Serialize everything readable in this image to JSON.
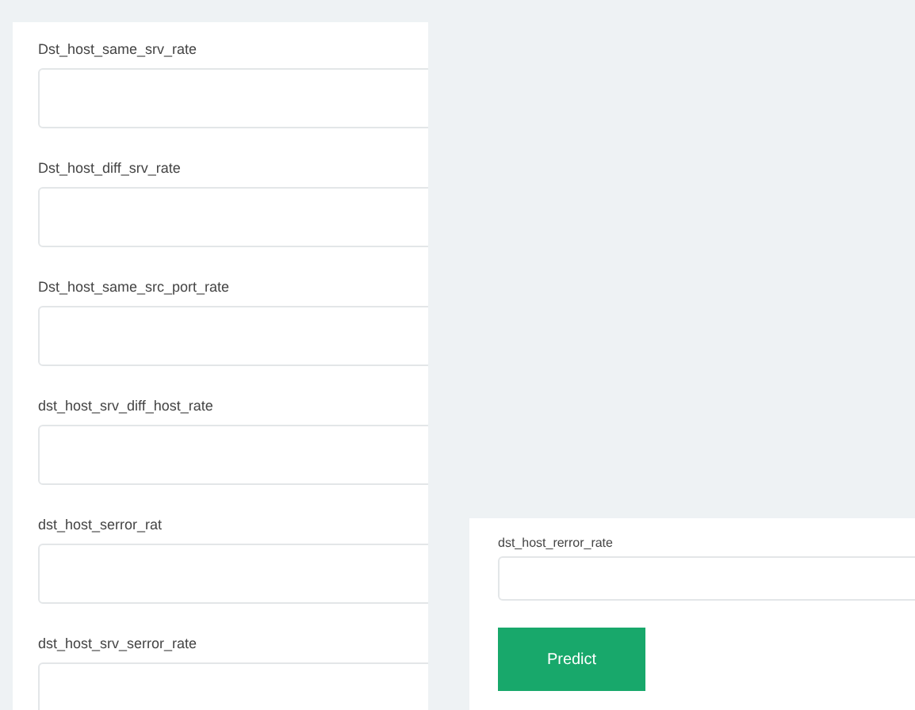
{
  "left_form": {
    "fields": [
      {
        "label": "Dst_host_same_srv_rate"
      },
      {
        "label": "Dst_host_diff_srv_rate"
      },
      {
        "label": "Dst_host_same_src_port_rate"
      },
      {
        "label": "dst_host_srv_diff_host_rate"
      },
      {
        "label": "dst_host_serror_rat"
      },
      {
        "label": "dst_host_srv_serror_rate"
      }
    ]
  },
  "right_form": {
    "fields": [
      {
        "label": "dst_host_rerror_rate"
      }
    ],
    "button": "Predict"
  }
}
